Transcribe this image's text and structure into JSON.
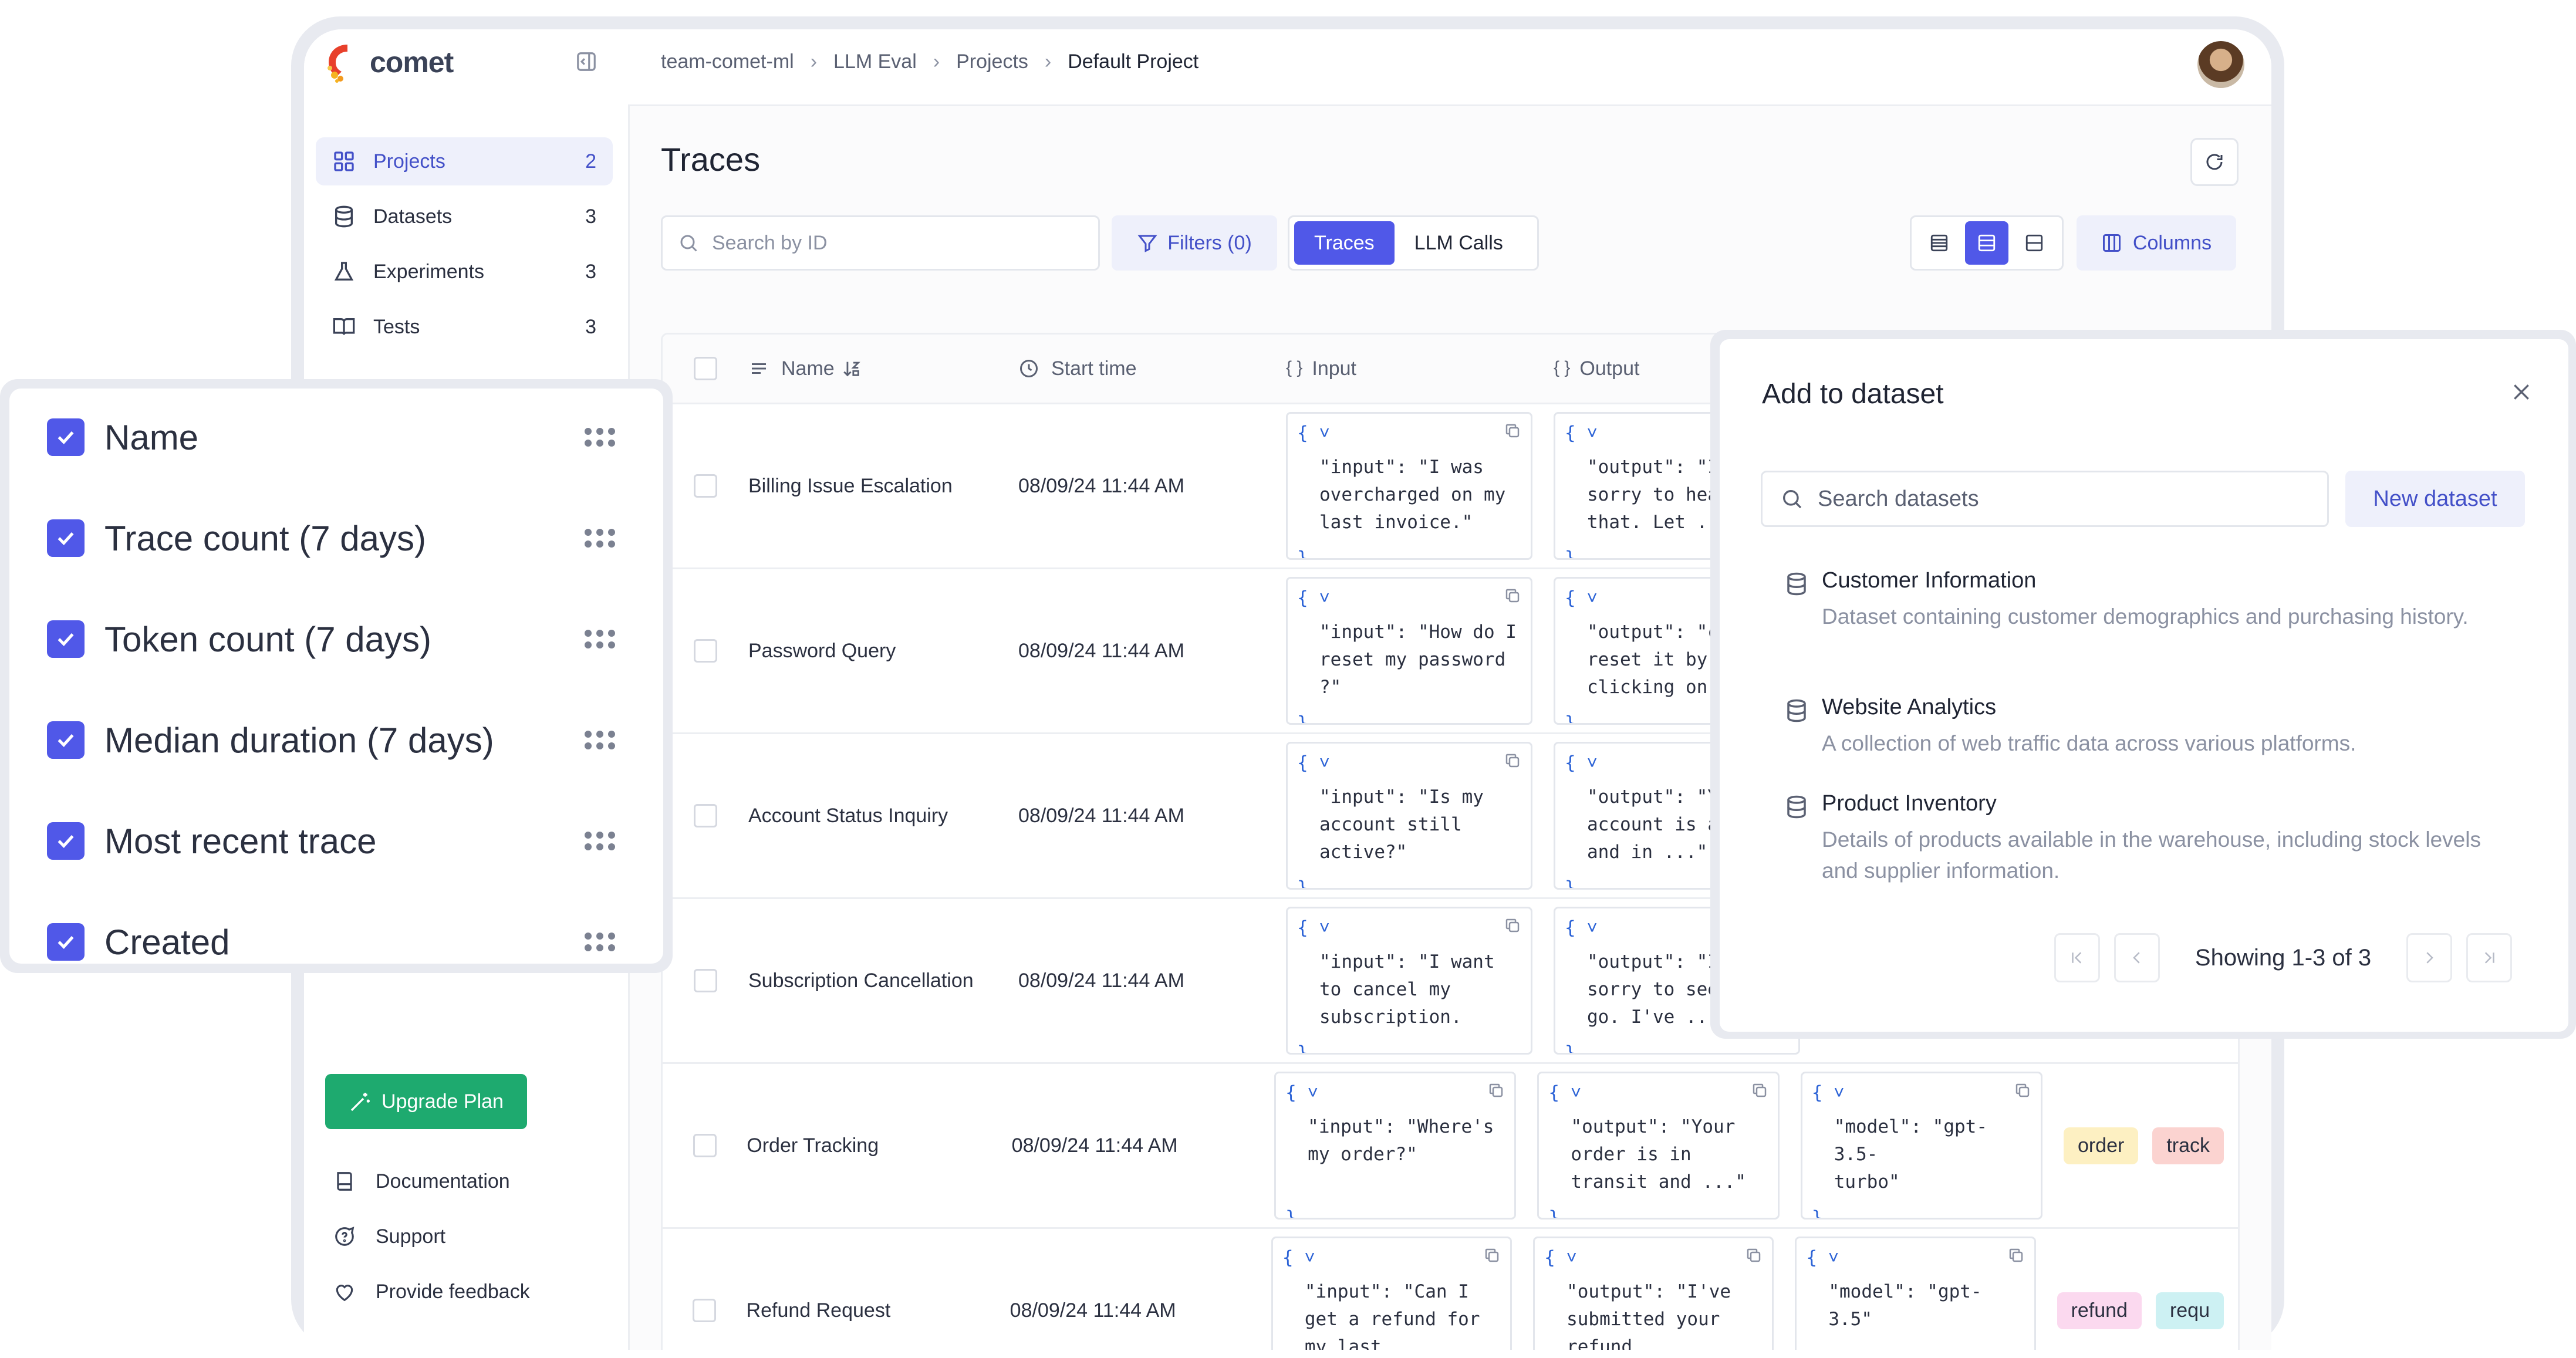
{
  "brand": {
    "name": "comet"
  },
  "breadcrumb": [
    "team-comet-ml",
    "LLM Eval",
    "Projects",
    "Default Project"
  ],
  "sidebar": {
    "items": [
      {
        "label": "Projects",
        "count": "2",
        "icon": "grid-icon"
      },
      {
        "label": "Datasets",
        "count": "3",
        "icon": "database-icon"
      },
      {
        "label": "Experiments",
        "count": "3",
        "icon": "flask-icon"
      },
      {
        "label": "Tests",
        "count": "3",
        "icon": "book-icon"
      }
    ],
    "upgrade_label": "Upgrade Plan",
    "bottom": [
      {
        "label": "Documentation",
        "icon": "book-icon"
      },
      {
        "label": "Support",
        "icon": "help-bubble-icon"
      },
      {
        "label": "Provide feedback",
        "icon": "heart-icon"
      }
    ]
  },
  "page": {
    "title": "Traces",
    "search_placeholder": "Search by ID",
    "filters_label": "Filters (0)",
    "tabs": [
      "Traces",
      "LLM Calls"
    ],
    "columns_label": "Columns"
  },
  "table": {
    "headers": {
      "name": "Name",
      "start_time": "Start time",
      "input": "Input",
      "output": "Output"
    },
    "rows": [
      {
        "name": "Billing Issue Escalation",
        "time": "08/09/24 11:44 AM",
        "input": [
          "\"input\": \"I was",
          "overcharged on my",
          "last invoice.\""
        ],
        "output": [
          "\"output\": \"I",
          "sorry to hea",
          "that. Let ..."
        ]
      },
      {
        "name": "Password Query",
        "time": "08/09/24 11:44 AM",
        "input": [
          "\"input\": \"How do I",
          "reset my password",
          "?\""
        ],
        "output": [
          "\"output\": \"c",
          "reset it by",
          "clicking on"
        ]
      },
      {
        "name": "Account Status Inquiry",
        "time": "08/09/24 11:44 AM",
        "input": [
          "\"input\": \"Is my",
          "account still",
          "active?\""
        ],
        "output": [
          "\"output\": \"Y",
          "account is a",
          "and in ...\""
        ]
      },
      {
        "name": "Subscription Cancellation",
        "time": "08/09/24 11:44 AM",
        "input": [
          "\"input\": \"I want",
          "to cancel my",
          "subscription."
        ],
        "output": [
          "\"output\": \"I",
          "sorry to see",
          "go. I've ..."
        ]
      },
      {
        "name": "Order Tracking",
        "time": "08/09/24 11:44 AM",
        "input": [
          "\"input\": \"Where's",
          "my order?\""
        ],
        "output": [
          "\"output\": \"Your",
          "order is in",
          "transit and ...\""
        ],
        "metadata": [
          "\"model\": \"gpt-3.5-",
          "turbo\""
        ],
        "tags": [
          "order",
          "track"
        ]
      },
      {
        "name": "Refund Request",
        "time": "08/09/24 11:44 AM",
        "input": [
          "\"input\": \"Can I",
          "get a refund for",
          "my last purchase?\""
        ],
        "output": [
          "\"output\": \"I've",
          "submitted your",
          "refund request...\""
        ],
        "metadata": [
          "\"model\": \"gpt-3.5\""
        ],
        "tags": [
          "refund",
          "requ"
        ]
      }
    ]
  },
  "columns_panel": {
    "items": [
      "Name",
      "Trace count (7 days)",
      "Token count (7 days)",
      "Median duration (7 days)",
      "Most recent trace",
      "Created"
    ]
  },
  "dataset_dialog": {
    "title": "Add to dataset",
    "search_placeholder": "Search datasets",
    "new_label": "New dataset",
    "datasets": [
      {
        "name": "Customer Information",
        "desc": "Dataset containing customer demographics and purchasing history."
      },
      {
        "name": "Website Analytics",
        "desc": "A collection of web traffic data across various platforms."
      },
      {
        "name": "Product Inventory",
        "desc": "Details of products available in the warehouse, including stock levels and supplier information."
      }
    ],
    "pager_text": "Showing 1-3 of 3"
  },
  "colors": {
    "accent": "#5058e8",
    "accent_text": "#4350c8",
    "upgrade": "#1eaa6f",
    "tags": {
      "order": "#fdf0c2",
      "track": "#fbd3d0",
      "refund": "#fbd9ef",
      "requ": "#cdf1f3"
    }
  }
}
